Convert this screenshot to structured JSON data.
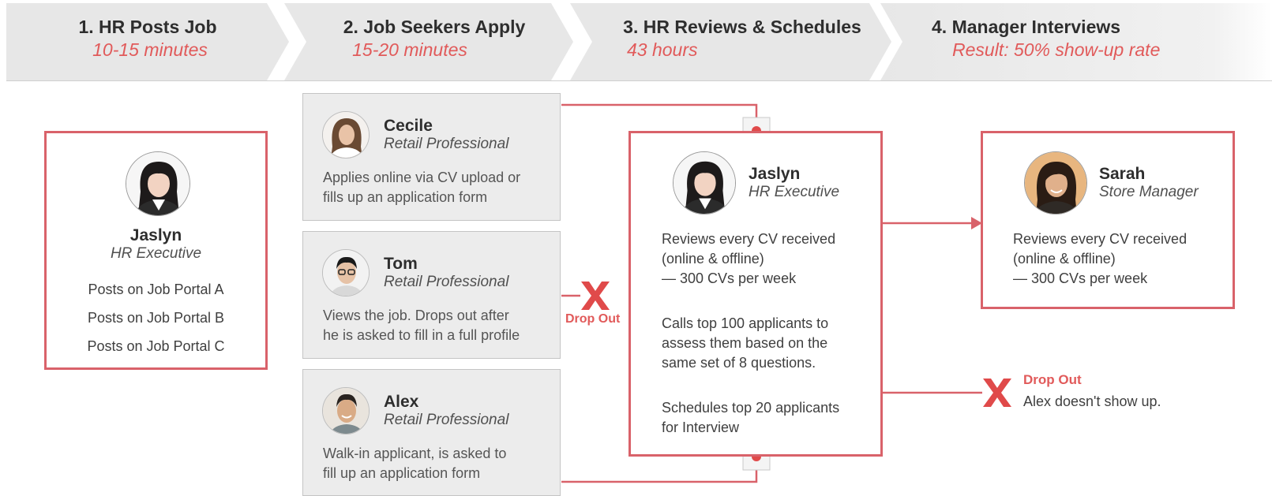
{
  "steps": [
    {
      "title": "1. HR Posts Job",
      "subtitle": "10-15 minutes"
    },
    {
      "title": "2. Job Seekers Apply",
      "subtitle": "15-20 minutes"
    },
    {
      "title": "3. HR Reviews & Schedules",
      "subtitle": "43 hours"
    },
    {
      "title": "4. Manager Interviews",
      "subtitle": "Result: 50% show-up rate"
    }
  ],
  "hr_post": {
    "name": "Jaslyn",
    "role": "HR Executive",
    "tasks": [
      "Posts on Job Portal A",
      "Posts on Job Portal B",
      "Posts on Job Portal C"
    ]
  },
  "seekers": [
    {
      "name": "Cecile",
      "role": "Retail Professional",
      "desc": [
        "Applies online via CV upload or",
        "fills up an application form"
      ]
    },
    {
      "name": "Tom",
      "role": "Retail Professional",
      "desc": [
        "Views the job. Drops out after",
        "he is asked to fill in a full profile"
      ]
    },
    {
      "name": "Alex",
      "role": "Retail Professional",
      "desc": [
        "Walk-in applicant, is asked to",
        "fill up an application form"
      ]
    }
  ],
  "hr_review": {
    "name": "Jaslyn",
    "role": "HR Executive",
    "para1": [
      "Reviews every CV received",
      "(online & offline)",
      "— 300 CVs per week"
    ],
    "para2": [
      "Calls top 100 applicants to",
      "assess them based on the",
      "same set of 8 questions."
    ],
    "para3": [
      "Schedules top 20 applicants",
      "for Interview"
    ]
  },
  "manager": {
    "name": "Sarah",
    "role": "Store Manager",
    "desc": [
      "Reviews every CV received",
      "(online & offline)",
      "— 300 CVs per week"
    ]
  },
  "dropouts": {
    "tom_label": "Drop Out",
    "alex_label": "Drop Out",
    "alex_note": "Alex doesn't show up."
  },
  "colors": {
    "accent": "#d9626a",
    "accent_text": "#e15a5a",
    "chevron": "#e9e9e9",
    "card": "#ececec"
  }
}
